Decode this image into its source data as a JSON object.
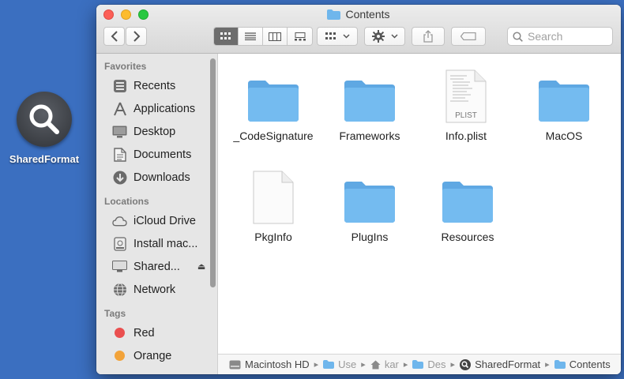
{
  "desktop_icon": {
    "label": "SharedFormat"
  },
  "window": {
    "title": "Contents"
  },
  "toolbar": {
    "search_placeholder": "Search"
  },
  "sidebar": {
    "sections": [
      {
        "heading": "Favorites",
        "items": [
          {
            "label": "Recents",
            "icon": "clock-icon"
          },
          {
            "label": "Applications",
            "icon": "applications-icon"
          },
          {
            "label": "Desktop",
            "icon": "desktop-icon"
          },
          {
            "label": "Documents",
            "icon": "document-icon"
          },
          {
            "label": "Downloads",
            "icon": "download-icon"
          }
        ]
      },
      {
        "heading": "Locations",
        "items": [
          {
            "label": "iCloud Drive",
            "icon": "cloud-icon"
          },
          {
            "label": "Install mac...",
            "icon": "disk-icon"
          },
          {
            "label": "Shared...",
            "icon": "display-icon"
          },
          {
            "label": "Network",
            "icon": "globe-icon"
          }
        ]
      },
      {
        "heading": "Tags",
        "items": [
          {
            "label": "Red",
            "color": "#ea4f4f"
          },
          {
            "label": "Orange",
            "color": "#f2a33a"
          }
        ]
      }
    ]
  },
  "files": [
    {
      "name": "_CodeSignature",
      "kind": "folder"
    },
    {
      "name": "Frameworks",
      "kind": "folder"
    },
    {
      "name": "Info.plist",
      "kind": "plist",
      "badge": "PLIST"
    },
    {
      "name": "MacOS",
      "kind": "folder"
    },
    {
      "name": "PkgInfo",
      "kind": "document"
    },
    {
      "name": "PlugIns",
      "kind": "folder"
    },
    {
      "name": "Resources",
      "kind": "folder"
    }
  ],
  "pathbar": {
    "crumbs": [
      "Macintosh HD",
      "Use",
      "kar",
      "Des",
      "SharedFormat",
      "Contents"
    ]
  },
  "colors": {
    "folder": "#6fb6ec",
    "desktop": "#3b6fc0"
  }
}
